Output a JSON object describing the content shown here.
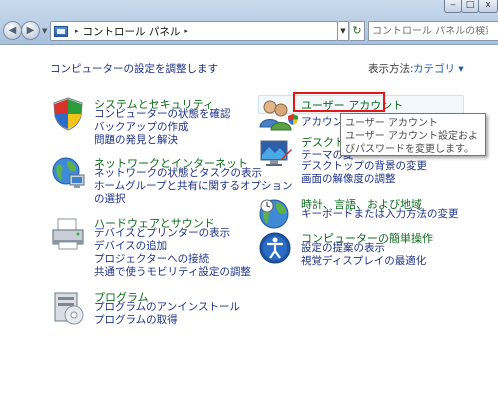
{
  "window": {
    "minimize": "‒",
    "maximize": "□",
    "close": "x"
  },
  "nav": {
    "back": "◀",
    "forward": "▶",
    "history": "▼"
  },
  "address": {
    "separator": "▸",
    "path": "コントロール パネル",
    "separator_end": "▸",
    "dropdown": "▼",
    "refresh": "↻"
  },
  "search": {
    "placeholder": "コントロール パネルの検索",
    "icon": "search-icon"
  },
  "header": {
    "heading": "コンピューターの設定を調整します",
    "view_label": "表示方法:",
    "view_value": "カテゴリ ▾"
  },
  "categories": {
    "system": {
      "title": "システムとセキュリティ",
      "links": [
        "コンピューターの状態を確認",
        "バックアップの作成",
        "問題の発見と解決"
      ]
    },
    "network": {
      "title": "ネットワークとインターネット",
      "links": [
        "ネットワークの状態とタスクの表示",
        "ホームグループと共有に関するオプション",
        "の選択"
      ]
    },
    "hardware": {
      "title": "ハードウェアとサウンド",
      "links": [
        "デバイスとプリンターの表示",
        "デバイスの追加",
        "プロジェクターへの接続",
        "共通で使うモビリティ設定の調整"
      ]
    },
    "programs": {
      "title": "プログラム",
      "links": [
        "プログラムのアンインストール",
        "プログラムの取得"
      ]
    },
    "user": {
      "title": "ユーザー アカウント",
      "partial_link": "アカウン"
    },
    "appearance": {
      "title_partial": "デスクトッ",
      "links_partial": "テーマの変",
      "links": [
        "デスクトップの背景の変更",
        "画面の解像度の調整"
      ]
    },
    "clock": {
      "title": "時計、言語、および地域",
      "links": [
        "キーボードまたは入力方法の変更"
      ]
    },
    "access": {
      "title": "コンピューターの簡単操作",
      "links": [
        "設定の提案の表示",
        "視覚ディスプレイの最適化"
      ]
    }
  },
  "tooltip": {
    "title": "ユーザー アカウント",
    "description": "ユーザー アカウント設定およびパスワードを変更します。"
  },
  "colors": {
    "category_title": "#0d6b1c",
    "link": "#1e3287",
    "highlight": "#e01818"
  }
}
